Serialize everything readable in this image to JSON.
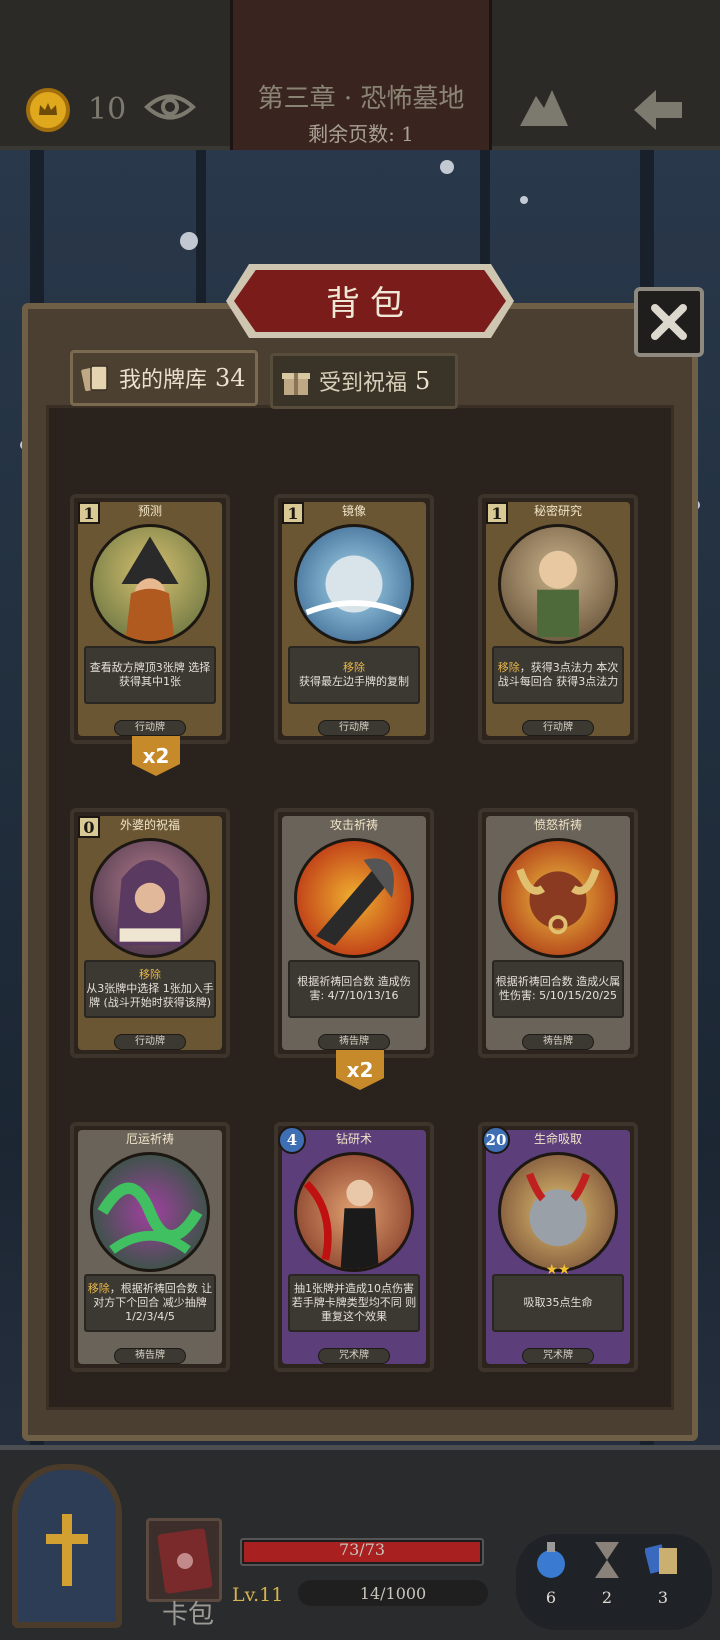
{
  "header": {
    "coins": "10",
    "chapter_title": "第三章 · 恐怖墓地",
    "pages_left": "剩余页数: 1"
  },
  "panel": {
    "title": "背包",
    "tabs": [
      {
        "label": "我的牌库",
        "count": "34"
      },
      {
        "label": "受到祝福",
        "count": "5"
      }
    ]
  },
  "cards": [
    {
      "cost": "1",
      "name": "预测",
      "desc_hl": "",
      "desc": "查看敌方牌顶3张牌 选择获得其中1张",
      "type": "行动牌",
      "badge": "x2"
    },
    {
      "cost": "1",
      "name": "镜像",
      "desc_hl": "移除",
      "desc": "获得最左边手牌的复制",
      "type": "行动牌",
      "badge": ""
    },
    {
      "cost": "1",
      "name": "秘密研究",
      "desc_hl": "移除",
      "desc": "，获得3点法力 本次战斗每回合 获得3点法力",
      "type": "行动牌",
      "badge": ""
    },
    {
      "cost": "0",
      "name": "外婆的祝福",
      "desc_hl": "移除",
      "desc": "从3张牌中选择 1张加入手牌 (战斗开始时获得该牌)",
      "type": "行动牌",
      "badge": ""
    },
    {
      "cost": "",
      "name": "攻击祈祷",
      "desc_hl": "",
      "desc": "根据祈祷回合数 造成伤害: 4/7/10/13/16",
      "type": "祷告牌",
      "badge": "x2"
    },
    {
      "cost": "",
      "name": "愤怒祈祷",
      "desc_hl": "",
      "desc": "根据祈祷回合数 造成火属性伤害: 5/10/15/20/25",
      "type": "祷告牌",
      "badge": ""
    },
    {
      "cost": "",
      "name": "厄运祈祷",
      "desc_hl": "移除",
      "desc": "，根据祈祷回合数 让对方下个回合 减少抽牌1/2/3/4/5",
      "type": "祷告牌",
      "badge": ""
    },
    {
      "cost": "4",
      "name": "钻研术",
      "desc_hl": "",
      "desc": "抽1张牌并造成10点伤害 若手牌卡牌类型均不同 则重复这个效果",
      "type": "咒术牌",
      "badge": ""
    },
    {
      "cost": "20",
      "name": "生命吸取",
      "desc_hl": "",
      "desc": "吸取35点生命",
      "type": "咒术牌",
      "badge": "",
      "stars": "★★"
    }
  ],
  "bottom": {
    "hp": "73/73",
    "hp_fraction": 1.0,
    "level": "Lv.11",
    "xp": "14/1000",
    "deck_label": "卡包",
    "resources": [
      "6",
      "2",
      "3"
    ]
  },
  "colors": {
    "action_card": "#6b5633",
    "prayer_card": "#6a6359",
    "spell_card": "#5b3e7a",
    "highlight": "#e8b84a",
    "hp_red": "#a82020"
  }
}
